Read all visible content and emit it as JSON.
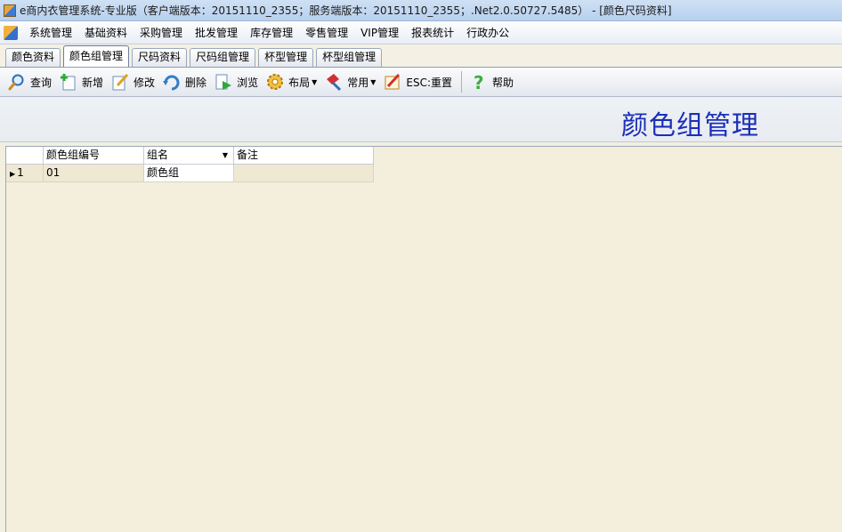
{
  "window": {
    "title": "e商内衣管理系统-专业版（客户端版本：20151110_2355；服务端版本：20151110_2355；.Net2.0.50727.5485） - [颜色尺码资料]"
  },
  "menu": {
    "items": [
      "系统管理",
      "基础资料",
      "采购管理",
      "批发管理",
      "库存管理",
      "零售管理",
      "VIP管理",
      "报表统计",
      "行政办公"
    ]
  },
  "tabs": {
    "items": [
      "颜色资料",
      "颜色组管理",
      "尺码资料",
      "尺码组管理",
      "杯型管理",
      "杯型组管理"
    ],
    "active_index": 1
  },
  "toolbar": {
    "query": "查询",
    "add": "新增",
    "edit": "修改",
    "delete": "删除",
    "browse": "浏览",
    "layout": "布局",
    "common": "常用",
    "reset": "ESC:重置",
    "help": "帮助"
  },
  "page": {
    "title": "颜色组管理"
  },
  "grid": {
    "columns": [
      "颜色组编号",
      "组名",
      "备注"
    ],
    "rows": [
      {
        "index": "1",
        "code": "01",
        "name": "颜色组",
        "note": ""
      }
    ]
  },
  "colors": {
    "title_blue": "#1a2fb8",
    "grid_bg": "#f3efdc"
  }
}
